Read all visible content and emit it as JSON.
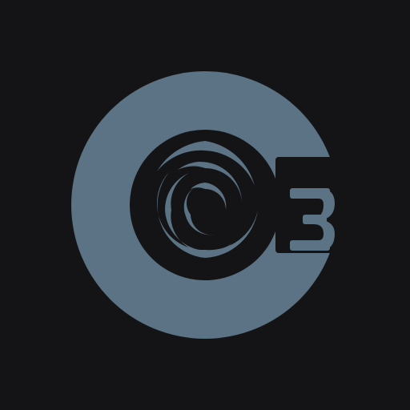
{
  "logo": {
    "mark": "C3",
    "glyph": "3",
    "icon": "c3-swirl-logo-icon"
  },
  "colors": {
    "background": "#141416",
    "primary": "#5b7384",
    "inner": "#141416"
  }
}
